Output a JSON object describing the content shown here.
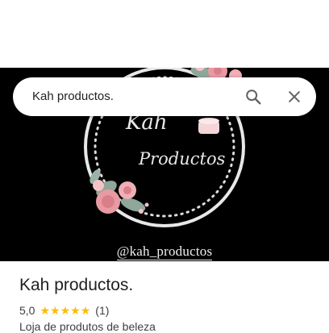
{
  "search": {
    "query": "Kah productos."
  },
  "hero": {
    "logo_line1": "Kah",
    "logo_line2": "Productos",
    "handle": "@kah_productos",
    "colors": {
      "background": "#000000",
      "ring": "#e8e8e8",
      "flower": "#e89aa3",
      "leaf": "#8fa79a"
    }
  },
  "place": {
    "title": "Kah productos.",
    "rating": "5,0",
    "stars": 5,
    "review_count": "(1)",
    "category": "Loja de produtos de beleza"
  },
  "colors": {
    "star": "#fbbc04",
    "text": "#202124",
    "secondary_text": "#3c4043"
  }
}
